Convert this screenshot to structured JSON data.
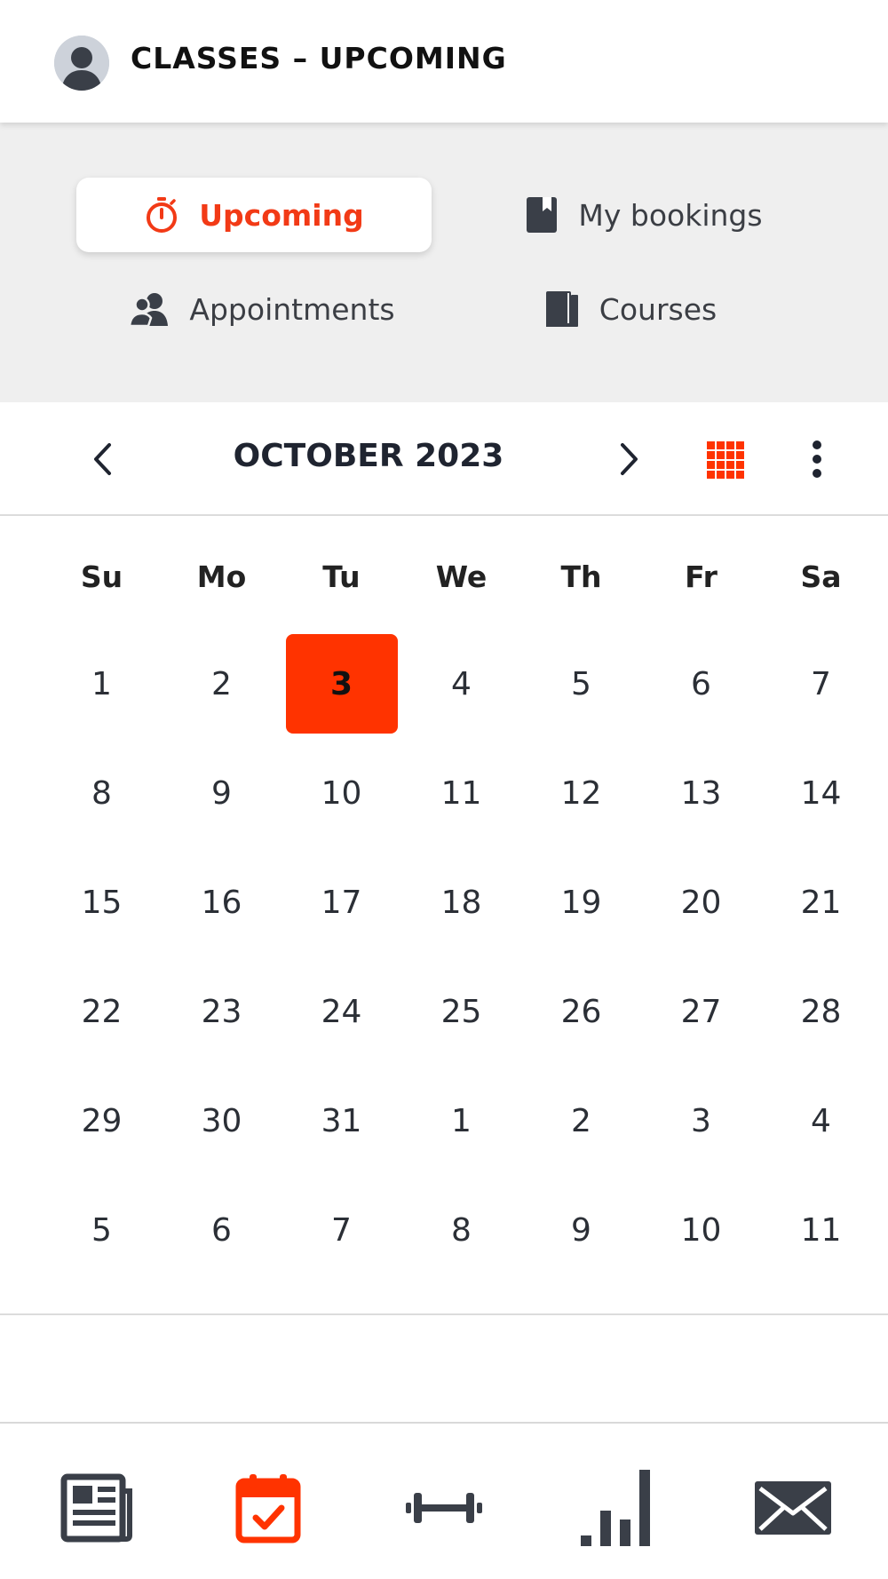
{
  "header": {
    "title": "CLASSES – UPCOMING"
  },
  "segments": {
    "upcoming": "Upcoming",
    "bookings": "My bookings",
    "appointments": "Appointments",
    "courses": "Courses"
  },
  "calendar": {
    "month_label": "OCTOBER 2023",
    "weekdays": [
      "Su",
      "Mo",
      "Tu",
      "We",
      "Th",
      "Fr",
      "Sa"
    ],
    "weeks": [
      [
        "1",
        "2",
        "3",
        "4",
        "5",
        "6",
        "7"
      ],
      [
        "8",
        "9",
        "10",
        "11",
        "12",
        "13",
        "14"
      ],
      [
        "15",
        "16",
        "17",
        "18",
        "19",
        "20",
        "21"
      ],
      [
        "22",
        "23",
        "24",
        "25",
        "26",
        "27",
        "28"
      ],
      [
        "29",
        "30",
        "31",
        "1",
        "2",
        "3",
        "4"
      ],
      [
        "5",
        "6",
        "7",
        "8",
        "9",
        "10",
        "11"
      ]
    ],
    "selected_day": "3"
  },
  "colors": {
    "accent": "#ff3300",
    "active_text": "#f23a16",
    "icon_dark": "#3a3f48",
    "segment_bg": "#efefef"
  },
  "icons": {
    "segments": [
      "stopwatch-icon",
      "bookmark-icon",
      "people-icon",
      "book-icon"
    ],
    "month_nav": [
      "chevron-left-icon",
      "chevron-right-icon",
      "grid-icon",
      "more-vertical-icon"
    ],
    "tabs": [
      "newspaper-icon",
      "calendar-check-icon",
      "dumbbell-icon",
      "bar-chart-icon",
      "mail-icon"
    ]
  },
  "active_tab": "calendar"
}
